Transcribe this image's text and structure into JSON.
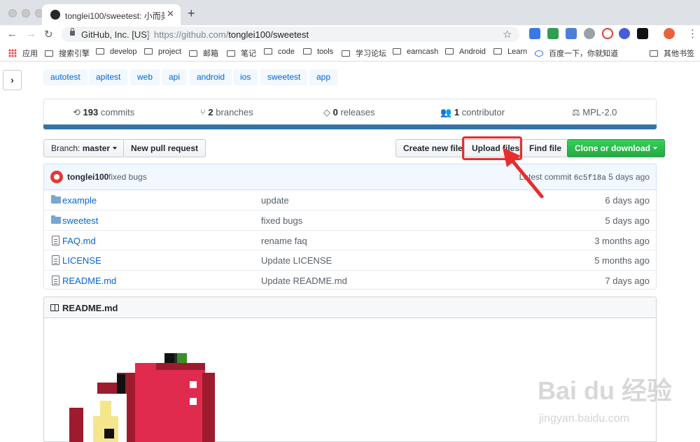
{
  "browser": {
    "tab_title": "tonglei100/sweetest: 小而美的",
    "tab_close": "✕",
    "new_tab": "+",
    "site_identity": "GitHub, Inc. [US]",
    "url_prefix": "https://github.com/",
    "url_path": "tonglei100/sweetest",
    "bookmarks": [
      "应用",
      "搜索引擎",
      "develop",
      "project",
      "邮箱",
      "笔记",
      "code",
      "tools",
      "学习论坛",
      "earncash",
      "Android",
      "Learn",
      "百度一下，你就知道",
      "其他书签"
    ]
  },
  "topics": [
    "autotest",
    "apitest",
    "web",
    "api",
    "android",
    "ios",
    "sweetest",
    "app"
  ],
  "numbers": {
    "commits_count": "193",
    "commits_label": "commits",
    "branches_count": "2",
    "branches_label": "branches",
    "releases_count": "0",
    "releases_label": "releases",
    "contributors_count": "1",
    "contributors_label": "contributor",
    "license": "MPL-2.0"
  },
  "actions": {
    "branch_prefix": "Branch:",
    "branch_name": "master",
    "new_pull_request": "New pull request",
    "create_new_file": "Create new file",
    "upload_files": "Upload files",
    "find_file": "Find file",
    "clone_or_download": "Clone or download"
  },
  "commit": {
    "author": "tonglei100",
    "message": "fixed bugs",
    "latest_label": "Latest commit",
    "sha": "6c5f18a",
    "age": "5 days ago"
  },
  "files": [
    {
      "name": "example",
      "type": "dir",
      "message": "update",
      "age": "6 days ago"
    },
    {
      "name": "sweetest",
      "type": "dir",
      "message": "fixed bugs",
      "age": "5 days ago"
    },
    {
      "name": "FAQ.md",
      "type": "file",
      "message": "rename faq",
      "age": "3 months ago"
    },
    {
      "name": "LICENSE",
      "type": "file",
      "message": "Update LICENSE",
      "age": "5 months ago"
    },
    {
      "name": "README.md",
      "type": "file",
      "message": "Update README.md",
      "age": "7 days ago"
    }
  ],
  "readme": {
    "title": "README.md"
  },
  "watermark": {
    "brand": "Bai du 经验",
    "site": "jingyan.baidu.com"
  },
  "colors": {
    "accent": "#0366d6",
    "highlight": "#e62e2e",
    "green": "#28a745",
    "langbar": "#3572a5"
  }
}
